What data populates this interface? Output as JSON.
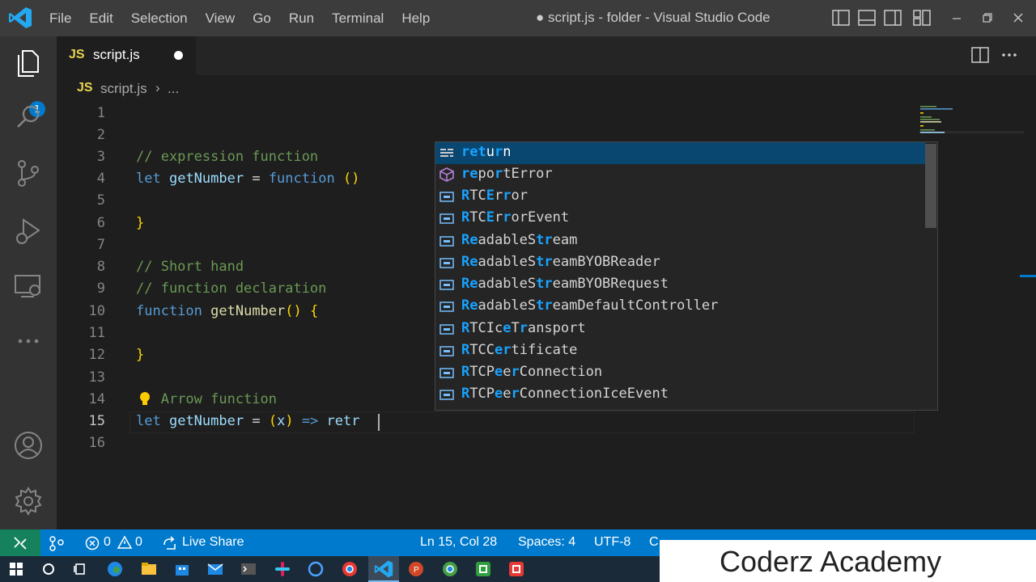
{
  "titlebar": {
    "menu": [
      "File",
      "Edit",
      "Selection",
      "View",
      "Go",
      "Run",
      "Terminal",
      "Help"
    ],
    "window_title": "● script.js - folder - Visual Studio Code"
  },
  "activity": {
    "explorer_badge": "1"
  },
  "tab": {
    "icon": "JS",
    "name": "script.js"
  },
  "breadcrumb": {
    "icon": "JS",
    "file": "script.js",
    "sep": "›",
    "more": "..."
  },
  "editor": {
    "line_numbers": [
      "1",
      "2",
      "3",
      "4",
      "5",
      "6",
      "7",
      "8",
      "9",
      "10",
      "11",
      "12",
      "13",
      "14",
      "15",
      "16"
    ],
    "current_line": 15
  },
  "suggest": {
    "items": [
      {
        "label": "return",
        "icon": "keyword-icon"
      },
      {
        "label": "reportError",
        "icon": "method-icon"
      },
      {
        "label": "RTCError",
        "icon": "variable-icon"
      },
      {
        "label": "RTCErrorEvent",
        "icon": "variable-icon"
      },
      {
        "label": "ReadableStream",
        "icon": "variable-icon"
      },
      {
        "label": "ReadableStreamBYOBReader",
        "icon": "variable-icon"
      },
      {
        "label": "ReadableStreamBYOBRequest",
        "icon": "variable-icon"
      },
      {
        "label": "ReadableStreamDefaultController",
        "icon": "variable-icon"
      },
      {
        "label": "RTCIceTransport",
        "icon": "variable-icon"
      },
      {
        "label": "RTCCertificate",
        "icon": "variable-icon"
      },
      {
        "label": "RTCPeerConnection",
        "icon": "variable-icon"
      },
      {
        "label": "RTCPeerConnectionIceEvent",
        "icon": "variable-icon"
      }
    ]
  },
  "status": {
    "errors": "0",
    "warnings": "0",
    "live_share": "Live Share",
    "position": "Ln 15, Col 28",
    "spaces": "Spaces: 4",
    "encoding": "UTF-8",
    "partial": "C"
  },
  "watermark": "Coderz Academy",
  "colors": {
    "accent": "#007acc",
    "selection": "#094771",
    "match": "#18a3ff"
  }
}
